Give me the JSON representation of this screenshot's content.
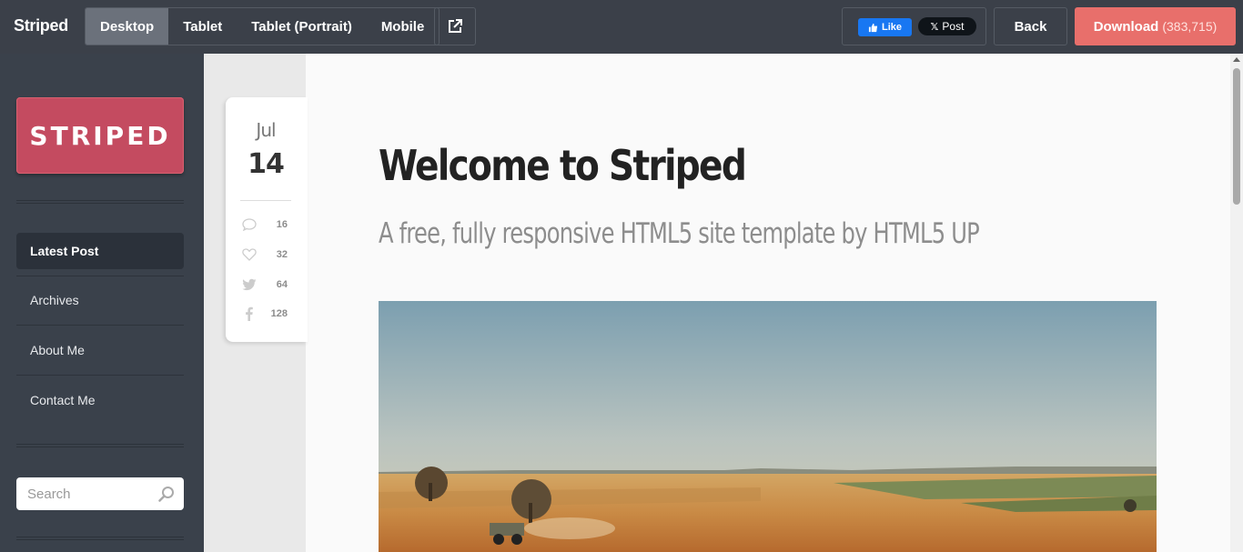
{
  "topbar": {
    "brand": "Striped",
    "devices": [
      "Desktop",
      "Tablet",
      "Tablet (Portrait)",
      "Mobile"
    ],
    "active_device": "Desktop",
    "fb_like": "Like",
    "x_post": "Post",
    "back": "Back",
    "download": "Download",
    "download_count": "(383,715)"
  },
  "sidebar": {
    "logo": "STRIPED",
    "nav": [
      {
        "label": "Latest Post",
        "active": true
      },
      {
        "label": "Archives",
        "active": false
      },
      {
        "label": "About Me",
        "active": false
      },
      {
        "label": "Contact Me",
        "active": false
      }
    ],
    "search": {
      "placeholder": "Search"
    }
  },
  "post": {
    "month": "Jul",
    "day": "14",
    "stats": [
      {
        "icon": "comment-icon",
        "count": "16"
      },
      {
        "icon": "heart-icon",
        "count": "32"
      },
      {
        "icon": "twitter-icon",
        "count": "64"
      },
      {
        "icon": "facebook-icon",
        "count": "128"
      }
    ],
    "title": "Welcome to Striped",
    "subtitle": "A free, fully responsive HTML5 site template by HTML5 UP"
  },
  "colors": {
    "topbar": "#3b4049",
    "sidebar": "#3a414b",
    "accent": "#c44b60",
    "download": "#e86f6b"
  }
}
